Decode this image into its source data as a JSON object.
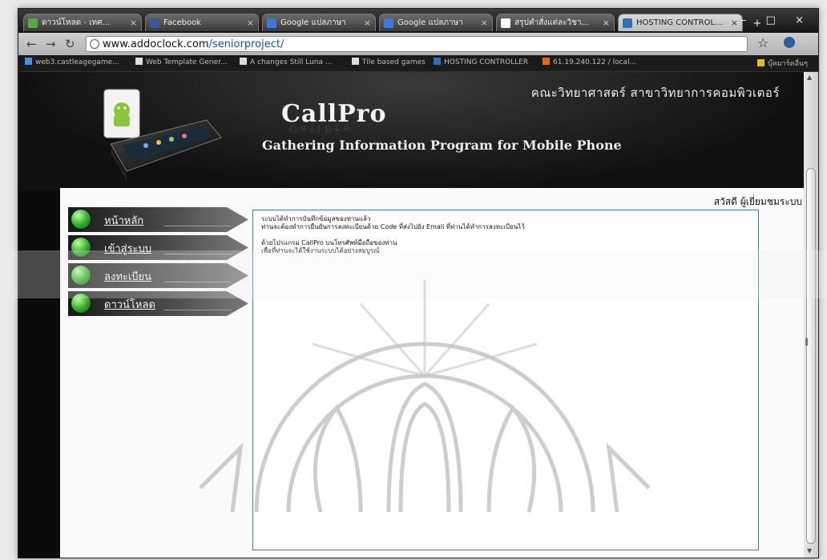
{
  "browser": {
    "tabs": [
      {
        "label": "ดาวน์โหลด - เทศ...",
        "favicon_color": "#55aa44",
        "active": false
      },
      {
        "label": "Facebook",
        "favicon_color": "#3b5998",
        "active": false
      },
      {
        "label": "Google แปลภาษา",
        "favicon_color": "#3d7ad8",
        "active": false
      },
      {
        "label": "Google แปลภาษา",
        "favicon_color": "#3d7ad8",
        "active": false
      },
      {
        "label": "สรุปคำสั่งแต่ละวิชา...",
        "favicon_color": "#ffffff",
        "active": false
      },
      {
        "label": "HOSTING CONTROL...",
        "favicon_color": "#2e6fb6",
        "active": true
      }
    ],
    "new_tab": "+",
    "window_controls": "– □ ×",
    "address": {
      "domain": "www.addoclock.com",
      "path": "/seniorproject/"
    },
    "bookmarks": [
      "web3.castleagegame...",
      "Web Template Gener...",
      "A changes Still Luna ...",
      "Tile based games",
      "HOSTING CONTROLLER",
      "61.19.240.122 / local...",
      "บุ๊คมาร์คอื่นๆ"
    ]
  },
  "site": {
    "faculty": "คณะวิทยาศาสตร์ สาขาวิทยาการคอมพิวเตอร์",
    "brand": "CallPro",
    "brand_reflection": "CallPro",
    "tagline": "Gathering Information Program for Mobile Phone",
    "greeting": "สวัสดี ผู้เยี่ยมชมระบบ",
    "menu": [
      "หน้าหลัก",
      "เข้าสู่ระบบ",
      "ลงทะเบียน",
      "ดาวน์โหลด"
    ],
    "message": {
      "line1": "ระบบได้ทำการบันทึกข้อมูลของท่านแล้ว",
      "line2": "ท่านจะต้องทำการยืนยันการลงทะเบียนด้วย Code ที่ส่งไปยัง Email ที่ท่านได้ทำการลงทะเบียนไว้",
      "line3": "ด้วยโปรแกรม CallPro บนโทรศัพท์มือถือของท่าน",
      "line4": "เพื่อที่ท่านจะได้ใช้งานระบบได้อย่างสมบูรณ์"
    }
  },
  "colors": {
    "menu_ball": "#2fa82a",
    "content_border": "#3d7f97",
    "link": "#0a57a8"
  },
  "icons": {
    "phone": "android-phone-icon",
    "watermark": "university-emblem-watermark"
  }
}
